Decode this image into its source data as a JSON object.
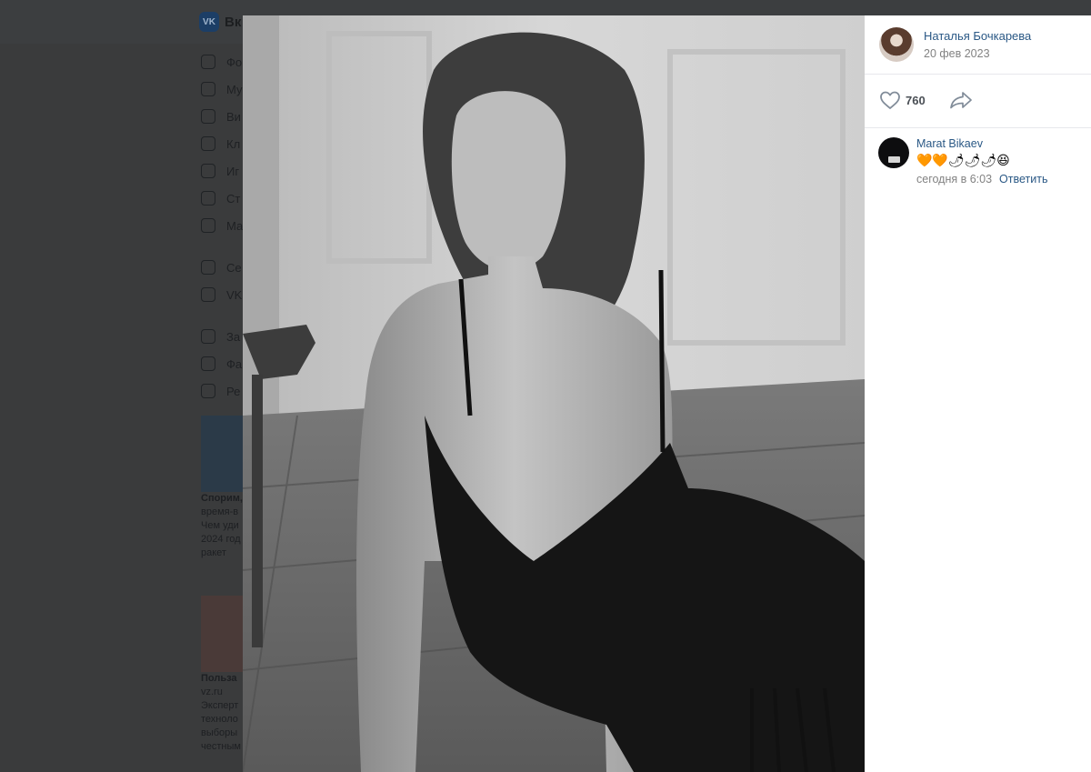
{
  "background": {
    "logo_mark": "VK",
    "logo_text": "Вк",
    "menu": [
      "Фо",
      "Му",
      "Ви",
      "Кл",
      "Иг",
      "Ст",
      "Ма",
      "Се",
      "VK",
      "За",
      "Фа",
      "Ре"
    ],
    "ads": [
      {
        "title": "Спорим,",
        "source": "время-в",
        "lines": [
          "Чем уди",
          "2024 год",
          "ракет"
        ]
      },
      {
        "title": "Польза",
        "source": "vz.ru",
        "lines": [
          "Эксперт",
          "техноло",
          "выборы",
          "честным"
        ]
      }
    ]
  },
  "post": {
    "author": "Наталья Бочкарева",
    "date": "20 фев 2023",
    "likes": "760"
  },
  "comments": [
    {
      "author": "Marat Bikaev",
      "text": "🧡🧡🌶🌶🌶😆",
      "time": "сегодня в 6:03",
      "reply_label": "Ответить"
    }
  ],
  "colors": {
    "link": "#2a5885",
    "meta": "#828282",
    "panel": "#ffffff",
    "overlay": "#2b2d2f"
  }
}
